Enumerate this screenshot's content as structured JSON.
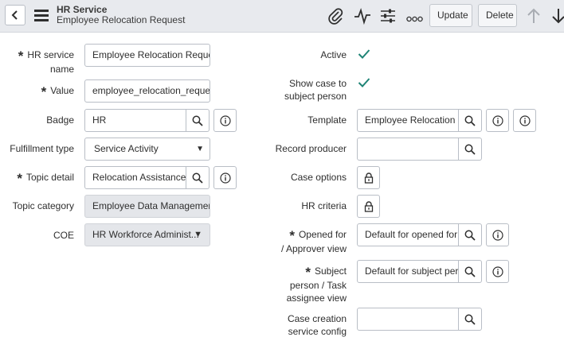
{
  "header": {
    "title": "HR Service",
    "subtitle": "Employee Relocation Request",
    "update_label": "Update",
    "delete_label": "Delete"
  },
  "form": {
    "left": {
      "hr_service_name": {
        "label_line1": "HR service",
        "label_line2": "name",
        "value": "Employee Relocation Request"
      },
      "value": {
        "label": "Value",
        "value": "employee_relocation_request"
      },
      "badge": {
        "label": "Badge",
        "value": "HR"
      },
      "fulfillment_type": {
        "label": "Fulfillment type",
        "value": "Service Activity"
      },
      "topic_detail": {
        "label": "Topic detail",
        "value": "Relocation Assistance"
      },
      "topic_category": {
        "label": "Topic category",
        "value": "Employee Data Management"
      },
      "coe": {
        "label": "COE",
        "value": "HR Workforce Administ..."
      }
    },
    "right": {
      "active": {
        "label": "Active",
        "checked": true
      },
      "show_case": {
        "label_line1": "Show case to",
        "label_line2": "subject person",
        "checked": true
      },
      "template": {
        "label": "Template",
        "value": "Employee Relocation"
      },
      "record_producer": {
        "label": "Record producer",
        "value": ""
      },
      "case_options": {
        "label": "Case options"
      },
      "hr_criteria": {
        "label": "HR criteria"
      },
      "opened_for": {
        "label_line1": "Opened for",
        "label_line2": "/ Approver view",
        "value": "Default for opened for"
      },
      "subject_person": {
        "label_line1": "Subject",
        "label_line2": "person / Task",
        "label_line3": "assignee view",
        "value": "Default for subject person"
      },
      "case_creation": {
        "label_line1": "Case creation",
        "label_line2": "service config",
        "value": ""
      }
    }
  },
  "colors": {
    "accent": "#1f8476",
    "header_bg": "#e8eaee",
    "readonly_bg": "#e4e6ea"
  }
}
